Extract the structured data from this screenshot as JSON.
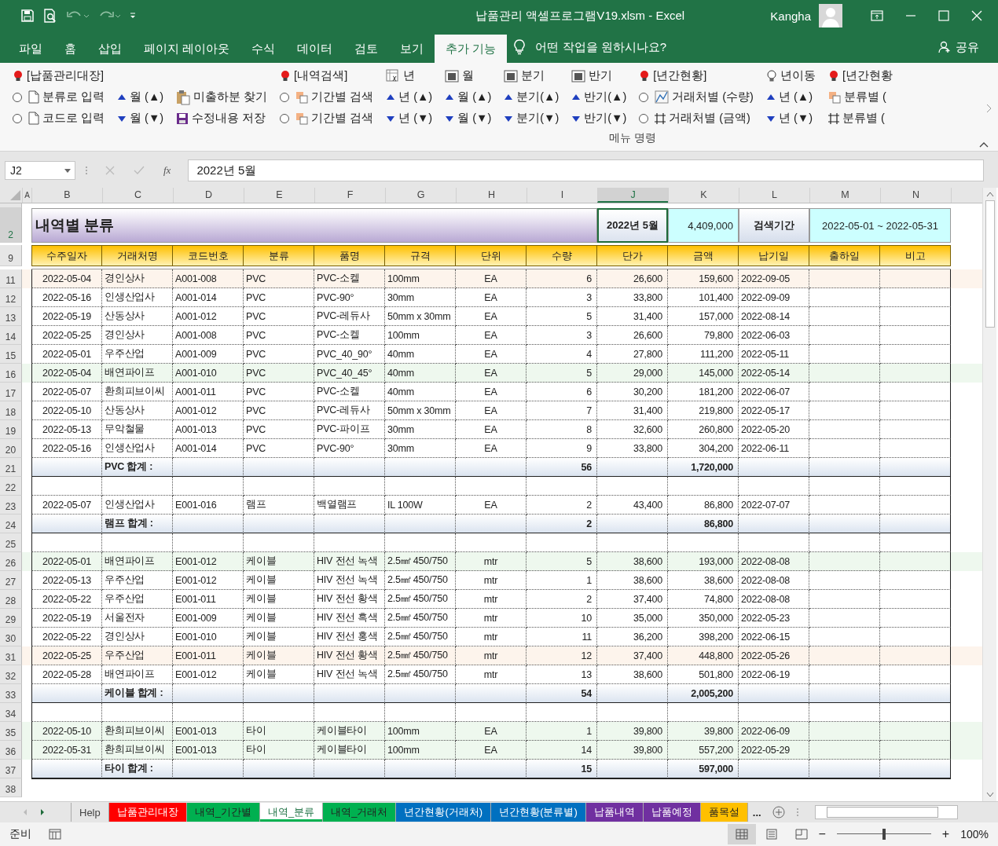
{
  "window": {
    "title": "납품관리 액셀프로그램V19.xlsm  -  Excel",
    "user": "Kangha"
  },
  "menu_tabs": [
    {
      "label": "파일",
      "selected": false
    },
    {
      "label": "홈",
      "selected": false
    },
    {
      "label": "삽입",
      "selected": false
    },
    {
      "label": "페이지 레이아웃",
      "selected": false
    },
    {
      "label": "수식",
      "selected": false
    },
    {
      "label": "데이터",
      "selected": false
    },
    {
      "label": "검토",
      "selected": false
    },
    {
      "label": "보기",
      "selected": false
    },
    {
      "label": "추가 기능",
      "selected": true
    }
  ],
  "tell_me": "어떤 작업을 원하시나요?",
  "share": "공유",
  "ribbon": {
    "group_label": "메뉴 명령",
    "columns": [
      [
        {
          "kind": "title",
          "label": "[납품관리대장]"
        },
        {
          "kind": "docradio",
          "label": "분류로 입력",
          "selected": false
        },
        {
          "kind": "docradio",
          "label": "코드로 입력",
          "selected": false
        }
      ],
      [
        {
          "kind": "space"
        },
        {
          "kind": "up",
          "label": "월 (▲)"
        },
        {
          "kind": "down",
          "label": "월 (▼)"
        }
      ],
      [
        {
          "kind": "space"
        },
        {
          "kind": "clip",
          "label": "미출하분 찾기"
        },
        {
          "kind": "save",
          "label": "수정내용 저장"
        }
      ],
      [
        {
          "kind": "title",
          "label": "[내역검색]"
        },
        {
          "kind": "shaperadio",
          "label": "기간별 검색",
          "selected": false
        },
        {
          "kind": "shaperadio",
          "label": "기간별 검색",
          "selected": false
        }
      ],
      [
        {
          "kind": "fx",
          "label": "년"
        },
        {
          "kind": "up",
          "label": "년 (▲)"
        },
        {
          "kind": "down",
          "label": "년 (▼)"
        }
      ],
      [
        {
          "kind": "grid",
          "label": "월"
        },
        {
          "kind": "up",
          "label": "월 (▲)"
        },
        {
          "kind": "down",
          "label": "월 (▼)"
        }
      ],
      [
        {
          "kind": "grid",
          "label": "분기"
        },
        {
          "kind": "up",
          "label": "분기(▲)"
        },
        {
          "kind": "down",
          "label": "분기(▼)"
        }
      ],
      [
        {
          "kind": "grid",
          "label": "반기"
        },
        {
          "kind": "up",
          "label": "반기(▲)"
        },
        {
          "kind": "down",
          "label": "반기(▼)"
        }
      ],
      [
        {
          "kind": "title",
          "label": "[년간현황]"
        },
        {
          "kind": "chartradio",
          "label": "거래처별 (수량)",
          "selected": false
        },
        {
          "kind": "frameradio",
          "label": "거래처별 (금액)",
          "selected": false
        }
      ],
      [
        {
          "kind": "bulb",
          "label": "년이동"
        },
        {
          "kind": "up",
          "label": "년 (▲)"
        },
        {
          "kind": "down",
          "label": "년 (▼)"
        }
      ],
      [
        {
          "kind": "title",
          "label": "[년간현황"
        },
        {
          "kind": "shape",
          "label": "분류별 ("
        },
        {
          "kind": "frame",
          "label": "분류별 ("
        }
      ]
    ]
  },
  "formula_bar": {
    "name_box": "J2",
    "fx": "fx",
    "formula": "2022년 5월"
  },
  "columns": [
    {
      "label": "A",
      "selected": false
    },
    {
      "label": "B",
      "selected": false
    },
    {
      "label": "C",
      "selected": false
    },
    {
      "label": "D",
      "selected": false
    },
    {
      "label": "E",
      "selected": false
    },
    {
      "label": "F",
      "selected": false
    },
    {
      "label": "G",
      "selected": false
    },
    {
      "label": "H",
      "selected": false
    },
    {
      "label": "I",
      "selected": false
    },
    {
      "label": "J",
      "selected": true
    },
    {
      "label": "K",
      "selected": false
    },
    {
      "label": "L",
      "selected": false
    },
    {
      "label": "M",
      "selected": false
    },
    {
      "label": "N",
      "selected": false
    }
  ],
  "title_row": {
    "row": "2",
    "row_selected": true,
    "title": "내역별 분류",
    "period": "2022년 5월",
    "total": "4,409,000",
    "range_label": "검색기간",
    "range": "2022-05-01 ~ 2022-05-31"
  },
  "header_row": {
    "row": "9",
    "headers": [
      "수주일자",
      "거래처명",
      "코드번호",
      "분류",
      "품명",
      "규격",
      "단위",
      "수량",
      "단가",
      "금액",
      "납기일",
      "출하일",
      "비고"
    ]
  },
  "rows": [
    {
      "row": "11",
      "kind": "data",
      "color": "#fdf4ec",
      "cells": [
        "2022-05-04",
        "경인상사",
        "A001-008",
        "PVC",
        "PVC-소켈",
        "100mm",
        "EA",
        "6",
        "26,600",
        "159,600",
        "2022-09-05"
      ]
    },
    {
      "row": "12",
      "kind": "data",
      "cells": [
        "2022-05-16",
        "인생산업사",
        "A001-014",
        "PVC",
        "PVC-90°",
        "30mm",
        "EA",
        "3",
        "33,800",
        "101,400",
        "2022-09-09"
      ]
    },
    {
      "row": "13",
      "kind": "data",
      "cells": [
        "2022-05-19",
        "산동상사",
        "A001-012",
        "PVC",
        "PVC-레듀사",
        "50mm x 30mm",
        "EA",
        "5",
        "31,400",
        "157,000",
        "2022-08-14"
      ]
    },
    {
      "row": "14",
      "kind": "data",
      "cells": [
        "2022-05-25",
        "경인상사",
        "A001-008",
        "PVC",
        "PVC-소켈",
        "100mm",
        "EA",
        "3",
        "26,600",
        "79,800",
        "2022-06-03"
      ]
    },
    {
      "row": "15",
      "kind": "data",
      "cells": [
        "2022-05-01",
        "우주산업",
        "A001-009",
        "PVC",
        "PVC_40_90°",
        "40mm",
        "EA",
        "4",
        "27,800",
        "111,200",
        "2022-05-11"
      ]
    },
    {
      "row": "16",
      "kind": "data",
      "color": "#eef8ee",
      "cells": [
        "2022-05-04",
        "배연파이프",
        "A001-010",
        "PVC",
        "PVC_40_45°",
        "40mm",
        "EA",
        "5",
        "29,000",
        "145,000",
        "2022-05-14"
      ]
    },
    {
      "row": "17",
      "kind": "data",
      "cells": [
        "2022-05-07",
        "환희피브이씨",
        "A001-011",
        "PVC",
        "PVC-소켈",
        "40mm",
        "EA",
        "6",
        "30,200",
        "181,200",
        "2022-06-07"
      ]
    },
    {
      "row": "18",
      "kind": "data",
      "cells": [
        "2022-05-10",
        "산동상사",
        "A001-012",
        "PVC",
        "PVC-레듀사",
        "50mm x 30mm",
        "EA",
        "7",
        "31,400",
        "219,800",
        "2022-05-17"
      ]
    },
    {
      "row": "19",
      "kind": "data",
      "cells": [
        "2022-05-13",
        "무악철물",
        "A001-013",
        "PVC",
        "PVC-파이프",
        "30mm",
        "EA",
        "8",
        "32,600",
        "260,800",
        "2022-05-20"
      ]
    },
    {
      "row": "20",
      "kind": "data",
      "cells": [
        "2022-05-16",
        "인생산업사",
        "A001-014",
        "PVC",
        "PVC-90°",
        "30mm",
        "EA",
        "9",
        "33,800",
        "304,200",
        "2022-06-11"
      ]
    },
    {
      "row": "21",
      "kind": "subtotal",
      "label": "PVC 합계  :",
      "qty": "56",
      "amount": "1,720,000"
    },
    {
      "row": "22",
      "kind": "blank"
    },
    {
      "row": "23",
      "kind": "data",
      "cells": [
        "2022-05-07",
        "인생산업사",
        "E001-016",
        "램프",
        "백열램프",
        "IL 100W",
        "EA",
        "2",
        "43,400",
        "86,800",
        "2022-07-07"
      ]
    },
    {
      "row": "24",
      "kind": "subtotal",
      "label": "램프 합계  :",
      "qty": "2",
      "amount": "86,800"
    },
    {
      "row": "25",
      "kind": "blank"
    },
    {
      "row": "26",
      "kind": "data",
      "color": "#eef8ee",
      "cells": [
        "2022-05-01",
        "배연파이프",
        "E001-012",
        "케이블",
        "HIV 전선 녹색",
        "2.5㎟ 450/750",
        "mtr",
        "5",
        "38,600",
        "193,000",
        "2022-08-08"
      ]
    },
    {
      "row": "27",
      "kind": "data",
      "cells": [
        "2022-05-13",
        "우주산업",
        "E001-012",
        "케이블",
        "HIV 전선 녹색",
        "2.5㎟ 450/750",
        "mtr",
        "1",
        "38,600",
        "38,600",
        "2022-08-08"
      ]
    },
    {
      "row": "28",
      "kind": "data",
      "cells": [
        "2022-05-22",
        "우주산업",
        "E001-011",
        "케이블",
        "HIV 전선 황색",
        "2.5㎟ 450/750",
        "mtr",
        "2",
        "37,400",
        "74,800",
        "2022-08-08"
      ]
    },
    {
      "row": "29",
      "kind": "data",
      "cells": [
        "2022-05-19",
        "서울전자",
        "E001-009",
        "케이블",
        "HIV 전선 흑색",
        "2.5㎟ 450/750",
        "mtr",
        "10",
        "35,000",
        "350,000",
        "2022-05-23"
      ]
    },
    {
      "row": "30",
      "kind": "data",
      "cells": [
        "2022-05-22",
        "경인상사",
        "E001-010",
        "케이블",
        "HIV 전선 홍색",
        "2.5㎟ 450/750",
        "mtr",
        "11",
        "36,200",
        "398,200",
        "2022-06-15"
      ]
    },
    {
      "row": "31",
      "kind": "data",
      "color": "#fdf4ec",
      "cells": [
        "2022-05-25",
        "우주산업",
        "E001-011",
        "케이블",
        "HIV 전선 황색",
        "2.5㎟ 450/750",
        "mtr",
        "12",
        "37,400",
        "448,800",
        "2022-05-26"
      ]
    },
    {
      "row": "32",
      "kind": "data",
      "cells": [
        "2022-05-28",
        "배연파이프",
        "E001-012",
        "케이블",
        "HIV 전선 녹색",
        "2.5㎟ 450/750",
        "mtr",
        "13",
        "38,600",
        "501,800",
        "2022-06-19"
      ]
    },
    {
      "row": "33",
      "kind": "subtotal",
      "label": "케이블 합계  :",
      "qty": "54",
      "amount": "2,005,200"
    },
    {
      "row": "34",
      "kind": "blank"
    },
    {
      "row": "35",
      "kind": "data",
      "color": "#eef8ee",
      "cells": [
        "2022-05-10",
        "환희피브이씨",
        "E001-013",
        "타이",
        "케이블타이",
        "100mm",
        "EA",
        "1",
        "39,800",
        "39,800",
        "2022-06-09"
      ]
    },
    {
      "row": "36",
      "kind": "data",
      "color": "#eef8ee",
      "cells": [
        "2022-05-31",
        "환희피브이씨",
        "E001-013",
        "타이",
        "케이블타이",
        "100mm",
        "EA",
        "14",
        "39,800",
        "557,200",
        "2022-05-29"
      ]
    },
    {
      "row": "37",
      "kind": "subtotal",
      "label": "타이 합계  :",
      "qty": "15",
      "amount": "597,000"
    },
    {
      "row": "38",
      "kind": "outside"
    }
  ],
  "sheet_tabs": [
    {
      "label": "Help",
      "selected": false
    },
    {
      "label": "납품관리대장",
      "selected": false,
      "color": "#ff0000"
    },
    {
      "label": "내역_기간별",
      "selected": false,
      "color": "#00b050"
    },
    {
      "label": "내역_분류",
      "selected": true,
      "color": "#00b050"
    },
    {
      "label": "내역_거래처",
      "selected": false,
      "color": "#00b050"
    },
    {
      "label": "년간현황(거래처)",
      "selected": false,
      "color": "#0070c0"
    },
    {
      "label": "년간현황(분류별)",
      "selected": false,
      "color": "#0070c0"
    },
    {
      "label": "납품내역",
      "selected": false,
      "color": "#7030a0"
    },
    {
      "label": "납품예정",
      "selected": false,
      "color": "#7030a0"
    },
    {
      "label": "품목설",
      "selected": false,
      "color": "#ffc000"
    }
  ],
  "more_tabs": "...",
  "status": {
    "text": "준비",
    "zoom": "100%",
    "zoom_out": "−",
    "zoom_in": "+",
    "level": 0.5
  }
}
